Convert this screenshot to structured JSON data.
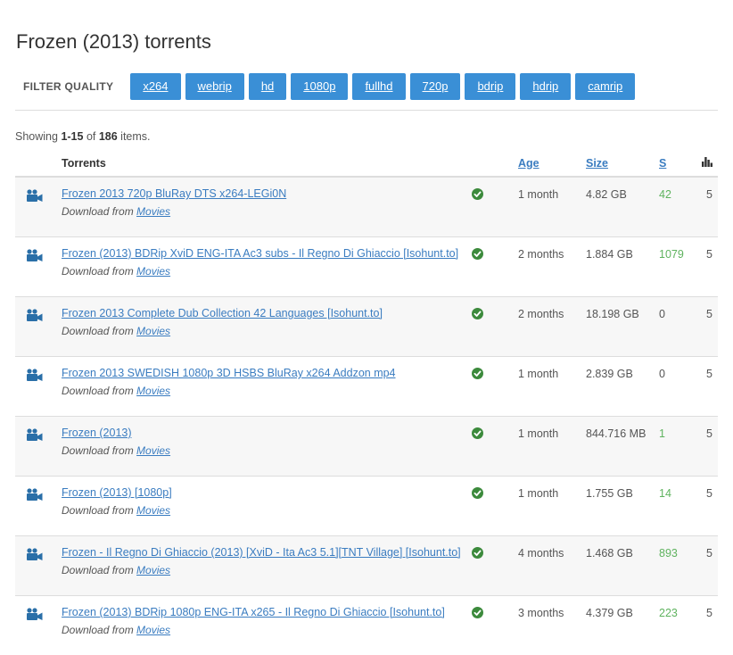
{
  "page": {
    "title": "Frozen (2013) torrents"
  },
  "filter": {
    "label": "FILTER QUALITY",
    "buttons": [
      "x264",
      "webrip",
      "hd",
      "1080p",
      "fullhd",
      "720p",
      "bdrip",
      "hdrip",
      "camrip"
    ]
  },
  "summary": {
    "prefix": "Showing ",
    "range": "1-15",
    "of": " of ",
    "total": "186",
    "suffix": " items."
  },
  "table": {
    "headers": {
      "torrents": "Torrents",
      "age": "Age",
      "size": "Size",
      "seeds": "S"
    },
    "download_prefix": "Download from ",
    "rows": [
      {
        "name": "Frozen 2013 720p BluRay DTS x264-LEGi0N",
        "category": "Movies",
        "age": "1 month",
        "size": "4.82 GB",
        "seeds": "42",
        "count": "5"
      },
      {
        "name": "Frozen (2013) BDRip XviD ENG-ITA Ac3 subs - Il Regno Di Ghiaccio [Isohunt.to]",
        "category": "Movies",
        "age": "2 months",
        "size": "1.884 GB",
        "seeds": "1079",
        "count": "5"
      },
      {
        "name": "Frozen 2013 Complete Dub Collection 42 Languages [Isohunt.to]",
        "category": "Movies",
        "age": "2 months",
        "size": "18.198 GB",
        "seeds": "0",
        "count": "5"
      },
      {
        "name": "Frozen 2013 SWEDISH 1080p 3D HSBS BluRay x264 Addzon mp4",
        "category": "Movies",
        "age": "1 month",
        "size": "2.839 GB",
        "seeds": "0",
        "count": "5"
      },
      {
        "name": "Frozen (2013)",
        "category": "Movies",
        "age": "1 month",
        "size": "844.716 MB",
        "seeds": "1",
        "count": "5"
      },
      {
        "name": "Frozen (2013) [1080p]",
        "category": "Movies",
        "age": "1 month",
        "size": "1.755 GB",
        "seeds": "14",
        "count": "5"
      },
      {
        "name": "Frozen - Il Regno Di Ghiaccio (2013) [XviD - Ita Ac3 5.1][TNT Village] [Isohunt.to]",
        "category": "Movies",
        "age": "4 months",
        "size": "1.468 GB",
        "seeds": "893",
        "count": "5"
      },
      {
        "name": "Frozen (2013) BDRip 1080p ENG-ITA x265 - Il Regno Di Ghiaccio [Isohunt.to]",
        "category": "Movies",
        "age": "3 months",
        "size": "4.379 GB",
        "seeds": "223",
        "count": "5"
      }
    ]
  },
  "icons": {
    "row_icon": "video-camera-icon",
    "verified_icon": "check-circle-icon",
    "stats_header_icon": "bar-chart-icon"
  },
  "colors": {
    "accent": "#3a8fd6",
    "link": "#3a7cc0",
    "seeds": "#5fb35f",
    "verified": "#3c8a3c",
    "camera": "#2a6fa8"
  }
}
